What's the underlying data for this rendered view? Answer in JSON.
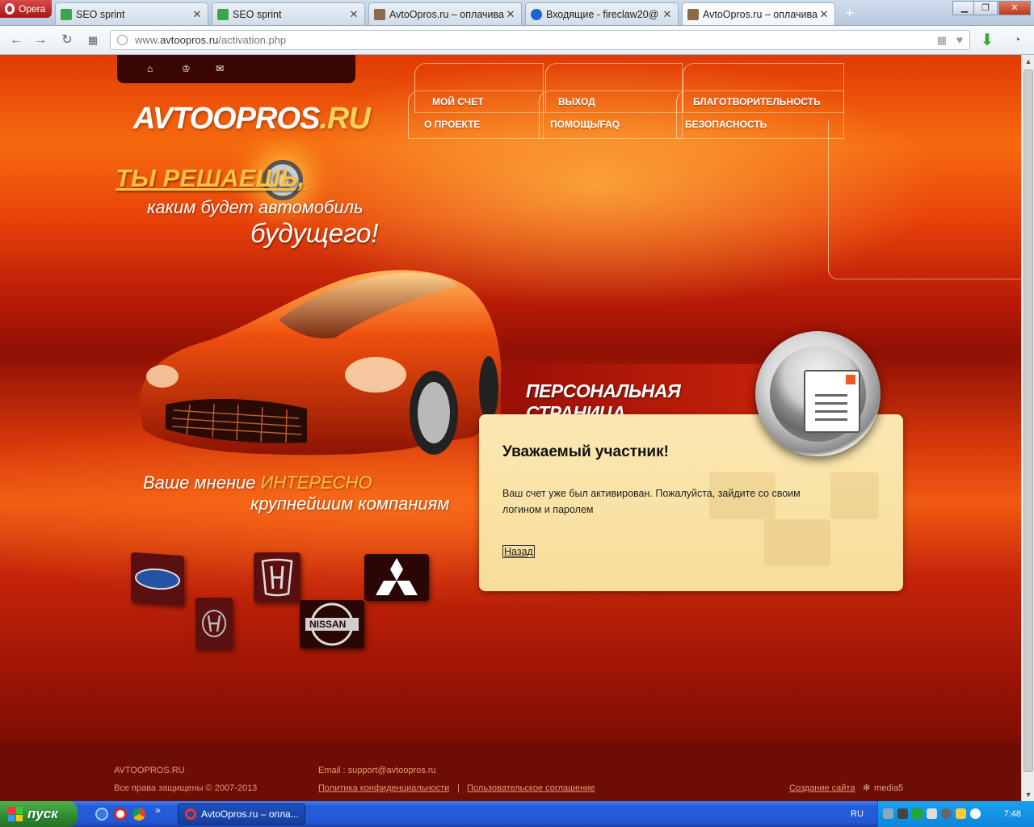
{
  "browser": {
    "menu_label": "Opera",
    "tabs": [
      {
        "title": "SEO sprint",
        "icon": "seosprint-favicon-icon",
        "active": false
      },
      {
        "title": "SEO sprint",
        "icon": "seosprint-favicon-icon",
        "active": false
      },
      {
        "title": "AvtoOpros.ru – оплачива",
        "icon": "avtoopros-favicon-icon",
        "active": false
      },
      {
        "title": "Входящие - fireclaw20@",
        "icon": "mail-favicon-icon",
        "active": false
      },
      {
        "title": "AvtoOpros.ru – оплачива",
        "icon": "avtoopros-favicon-icon",
        "active": true
      }
    ],
    "url_prefix": "www.",
    "url_host": "avtoopros.ru",
    "url_path": "/activation.php",
    "new_tab_label": "+"
  },
  "site": {
    "logo_main": "AVTOOPROS",
    "logo_accent": ".RU",
    "nav": {
      "account": "МОЙ СЧЕТ",
      "logout": "ВЫХОД",
      "charity": "БЛАГОТВОРИТЕЛЬНОСТЬ",
      "about": "О ПРОЕКТЕ",
      "help": "ПОМОЩЬ/FAQ",
      "security": "БЕЗОПАСНОСТЬ"
    },
    "slogan": {
      "line1": "ТЫ РЕШАЕШЬ,",
      "line2": "каким будет автомобиль",
      "line3": "будущего!"
    },
    "opinion": {
      "line1_start": "Ваше мнение ",
      "line1_accent": "ИНТЕРЕСНО",
      "line2": "крупнейшим компаниям"
    },
    "brands": {
      "nissan": "NISSAN"
    },
    "personal": {
      "title": "ПЕРСОНАЛЬНАЯ СТРАНИЦА",
      "heading": "Уважаемый участник!",
      "message": "Ваш счет уже был активирован. Пожалуйста, зайдите со своим логином и паролем",
      "back": "Назад"
    },
    "footer": {
      "brand": "AVTOOPROS.RU",
      "copyright": "Все права защищены © 2007-2013",
      "email": "Email : support@avtoopros.ru",
      "privacy": "Политика конфиденциальности",
      "separator": "|",
      "terms": "Пользовательское соглашение",
      "made_by": "Создание сайта",
      "studio": "media5"
    }
  },
  "taskbar": {
    "start_label": "пуск",
    "task": "AvtoOpros.ru – опла...",
    "lang": "RU",
    "time": "7:48",
    "more": "»"
  }
}
